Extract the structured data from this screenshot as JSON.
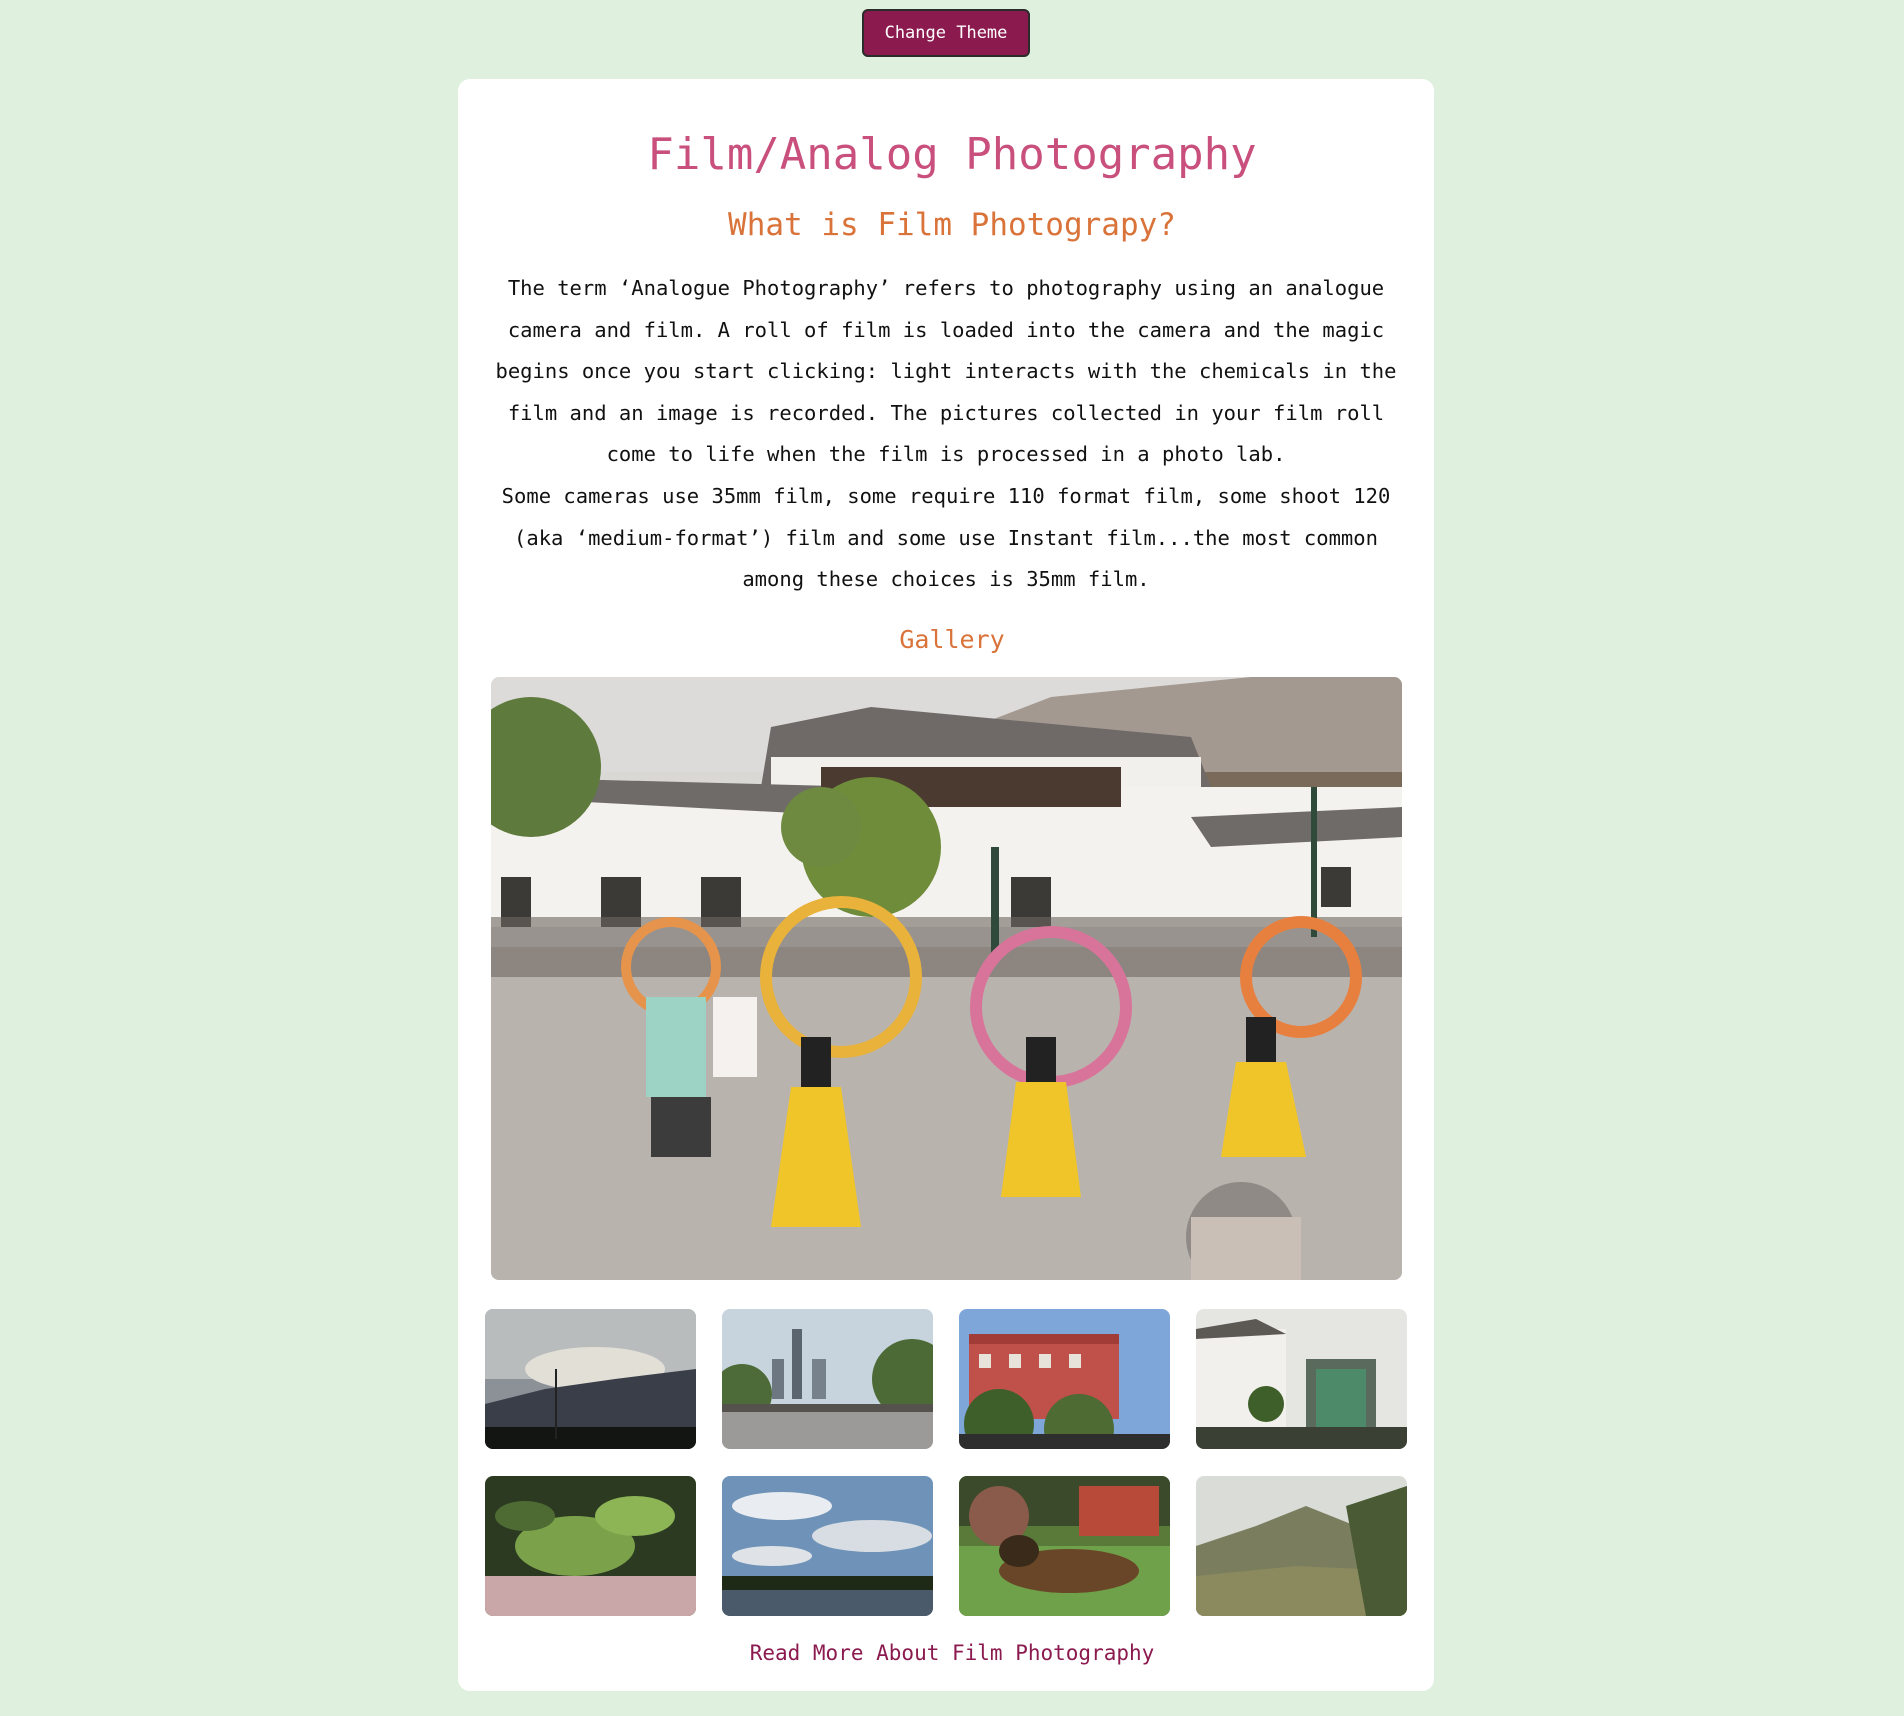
{
  "header": {
    "theme_button_label": "Change Theme"
  },
  "article": {
    "title": "Film/Analog Photography",
    "subtitle": "What is Film Photograpy?",
    "paragraphs": [
      "The term ‘Analogue Photography’ refers to photography using an analogue camera and film. A roll of film is loaded into the camera and the magic begins once you start clicking: light interacts with the chemicals in the film and an image is recorded. The pictures collected in your film roll come to life when the film is processed in a photo lab.",
      "Some cameras use 35mm film, some require 110 format film, some shoot 120 (aka ‘medium-format’) film and some use Instant film...the most common among these choices is 35mm film."
    ]
  },
  "gallery": {
    "heading": "Gallery"
  },
  "footer": {
    "read_more_label": "Read More About Film Photography"
  },
  "colors": {
    "page_background": "#dff1de",
    "card_background": "#ffffff",
    "button_background": "#8b1a4f",
    "title_color": "#c94f7c",
    "subtitle_color": "#d9733a",
    "link_color": "#8b1a4f"
  }
}
